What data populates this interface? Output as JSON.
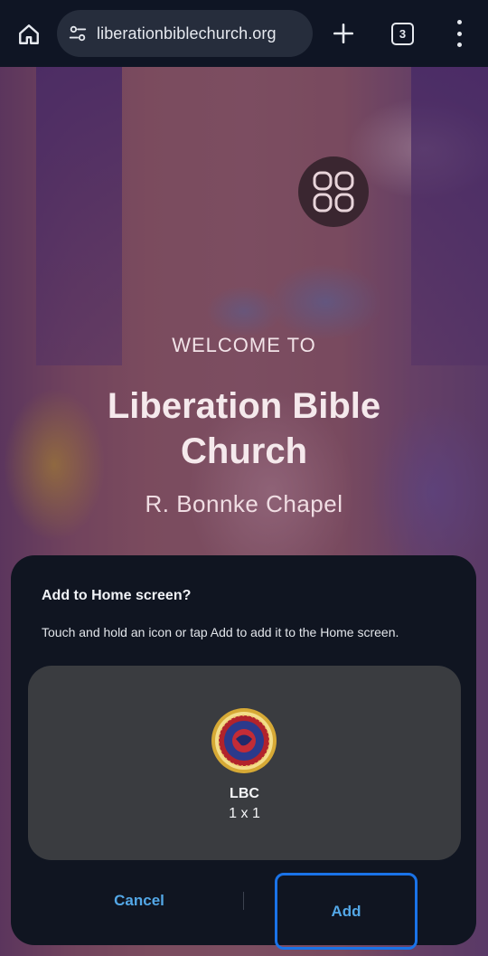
{
  "browser": {
    "url": "liberationbiblechurch.org",
    "tab_count": "3"
  },
  "hero": {
    "welcome": "WELCOME TO",
    "church_line1": "Liberation Bible",
    "church_line2": "Church",
    "chapel": "R. Bonnke Chapel"
  },
  "dialog": {
    "title": "Add to Home screen?",
    "message": "Touch and hold an icon or tap Add to add it to the Home screen.",
    "app_name": "LBC",
    "app_size": "1 x 1",
    "cancel_label": "Cancel",
    "add_label": "Add"
  },
  "colors": {
    "accent": "#53a7e6",
    "focus_ring": "#1a73e8",
    "dialog_bg": "#101521",
    "preview_bg": "#3a3c40"
  },
  "icons": {
    "home": "home-icon",
    "site_settings": "tune-icon",
    "new_tab": "plus-icon",
    "tabs": "tab-switcher-icon",
    "menu": "more-vert-icon",
    "site_logo": "grid-logo-icon",
    "app": "church-badge-icon"
  }
}
